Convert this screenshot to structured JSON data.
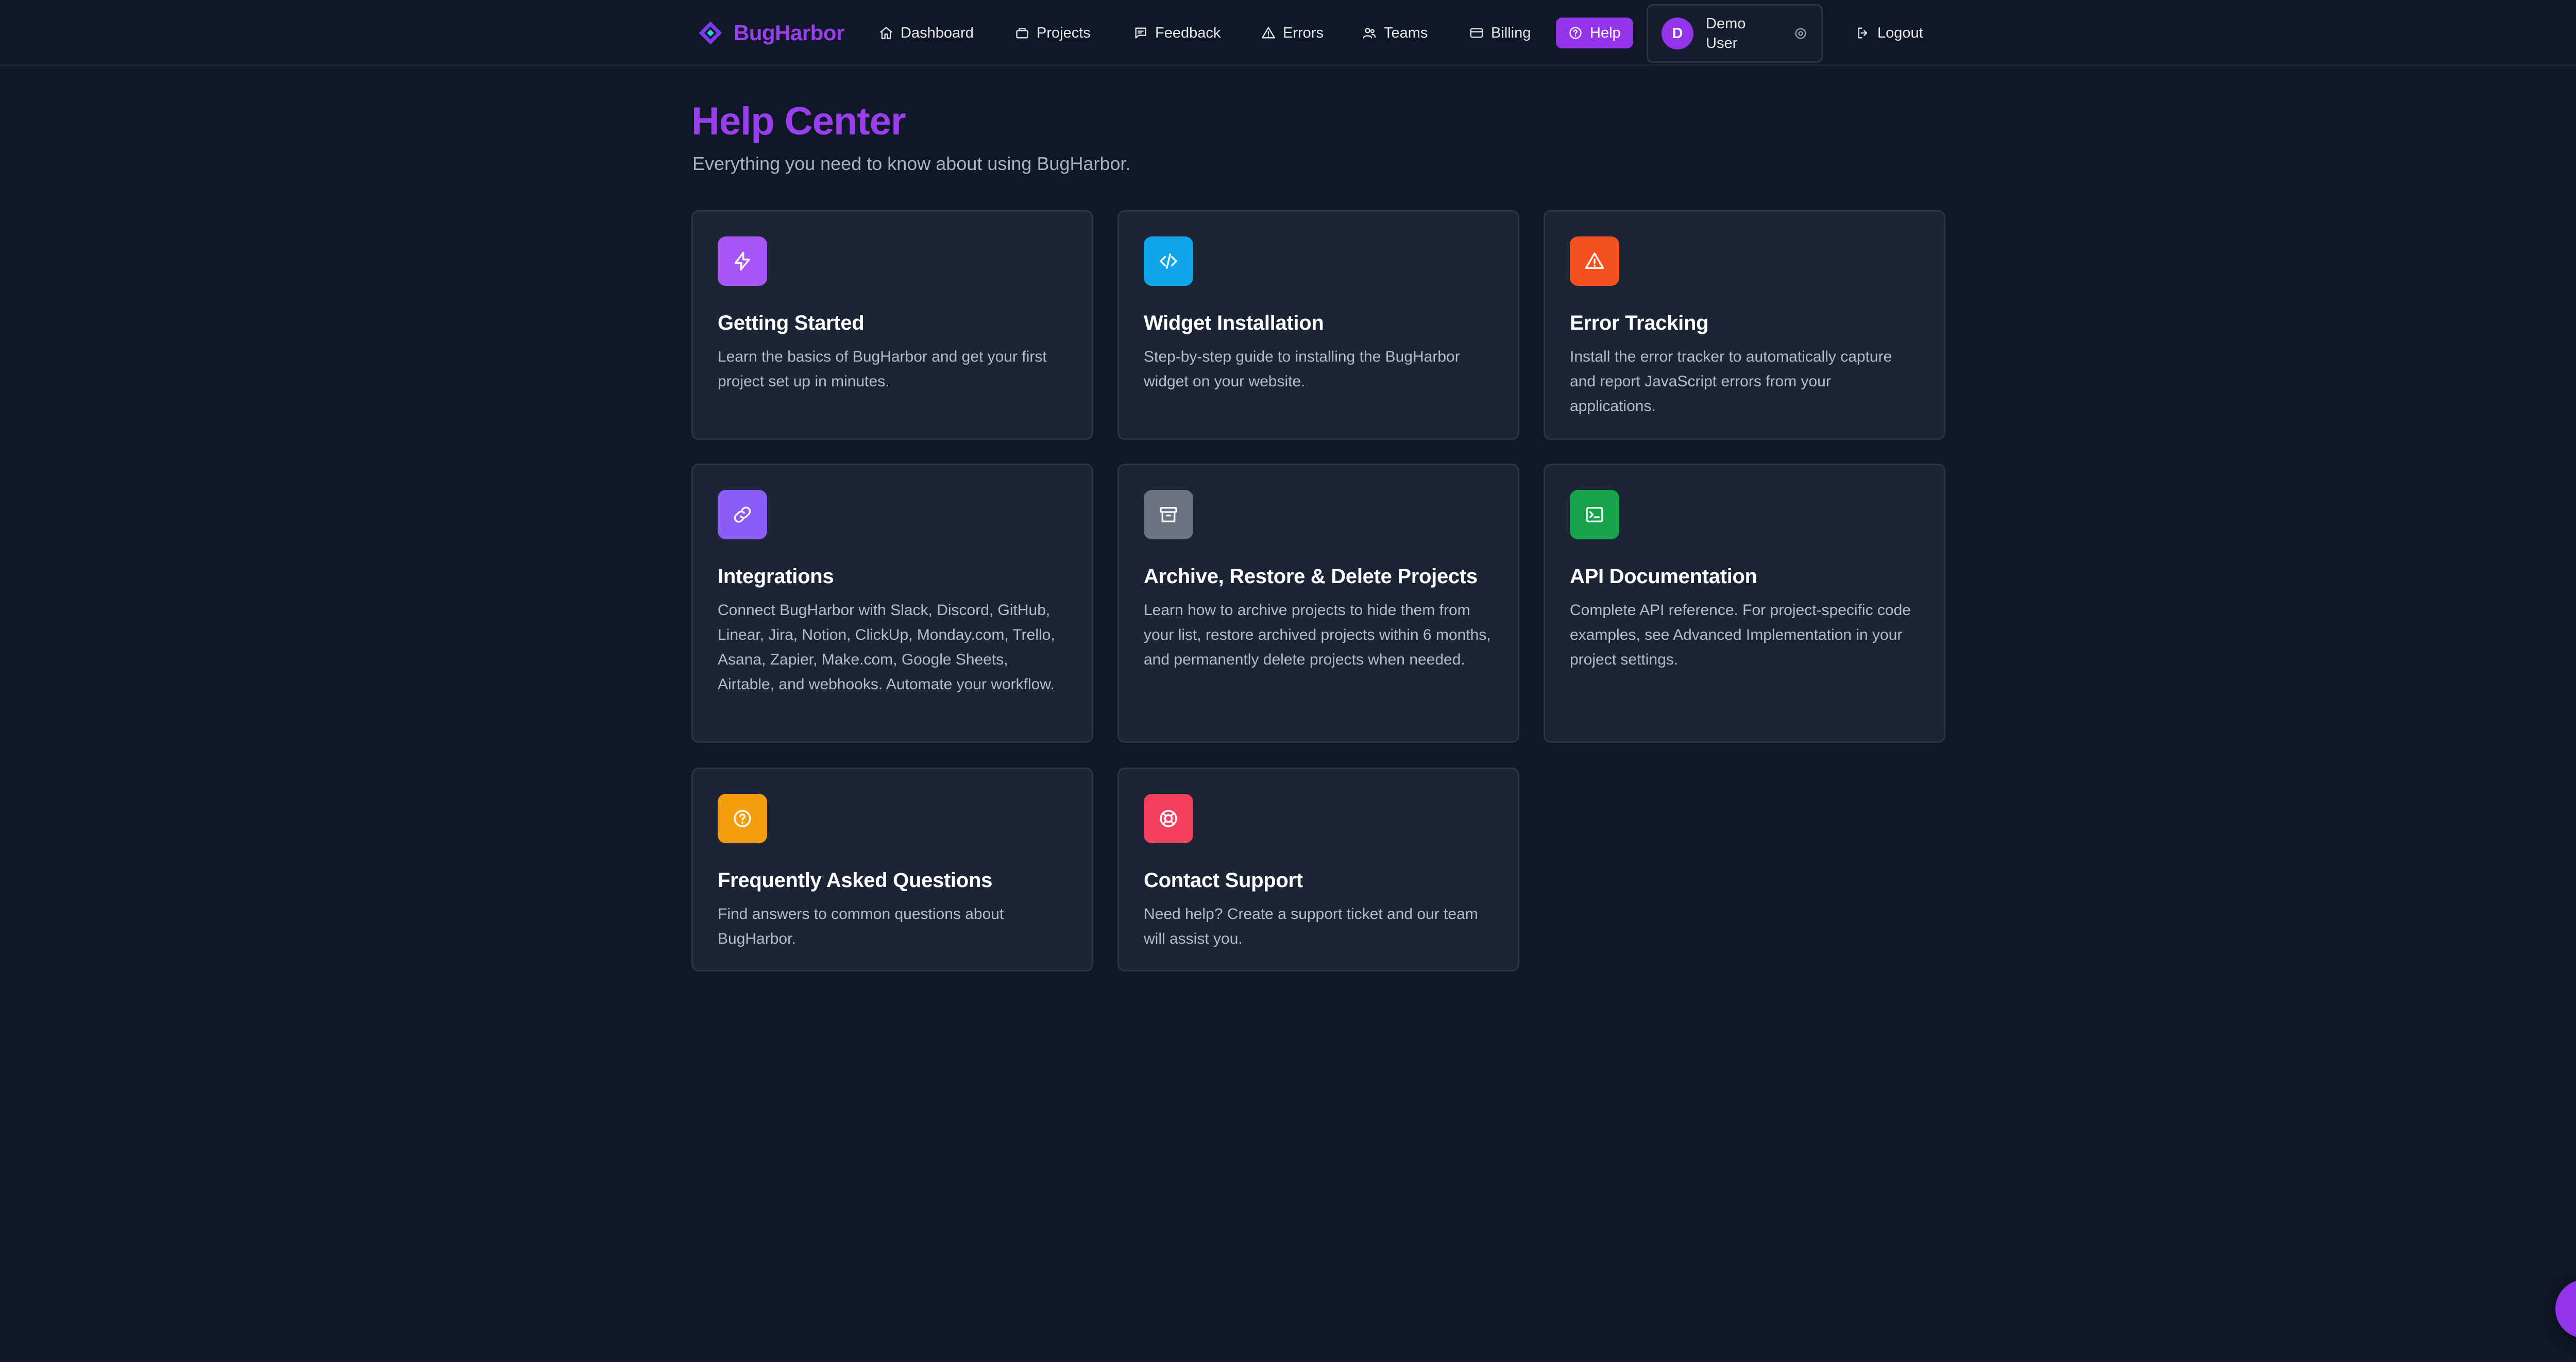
{
  "brand": {
    "name": "BugHarbor",
    "color": "#9b3ef0"
  },
  "nav": {
    "items": [
      {
        "label": "Dashboard",
        "icon": "home-icon"
      },
      {
        "label": "Projects",
        "icon": "folder-icon"
      },
      {
        "label": "Feedback",
        "icon": "message-icon"
      },
      {
        "label": "Errors",
        "icon": "alert-triangle-icon"
      },
      {
        "label": "Teams",
        "icon": "users-icon"
      },
      {
        "label": "Billing",
        "icon": "credit-card-icon"
      },
      {
        "label": "Help",
        "icon": "help-circle-icon",
        "active": true
      }
    ],
    "user": {
      "initial": "D",
      "name": "Demo User",
      "settings_icon": "settings-icon"
    },
    "logout": {
      "label": "Logout",
      "icon": "logout-icon"
    }
  },
  "header": {
    "title": "Help Center",
    "subtitle": "Everything you need to know about using BugHarbor."
  },
  "cards": [
    {
      "title": "Getting Started",
      "description": "Learn the basics of BugHarbor and get your first project set up in minutes.",
      "icon": "lightning-icon",
      "icon_color": "#a855f7"
    },
    {
      "title": "Widget Installation",
      "description": "Step-by-step guide to installing the BugHarbor widget on your website.",
      "icon": "code-icon",
      "icon_color": "#0ea5e9"
    },
    {
      "title": "Error Tracking",
      "description": "Install the error tracker to automatically capture and report JavaScript errors from your applications.",
      "icon": "alert-triangle-icon",
      "icon_color": "#f4511e"
    },
    {
      "title": "Integrations",
      "description": "Connect BugHarbor with Slack, Discord, GitHub, Linear, Jira, Notion, ClickUp, Monday.com, Trello, Asana, Zapier, Make.com, Google Sheets, Airtable, and webhooks. Automate your workflow.",
      "icon": "link-icon",
      "icon_color": "#8b5cf6"
    },
    {
      "title": "Archive, Restore & Delete Projects",
      "description": "Learn how to archive projects to hide them from your list, restore archived projects within 6 months, and permanently delete projects when needed.",
      "icon": "archive-icon",
      "icon_color": "#6b7280"
    },
    {
      "title": "API Documentation",
      "description": "Complete API reference. For project-specific code examples, see Advanced Implementation in your project settings.",
      "icon": "terminal-icon",
      "icon_color": "#16a34a"
    },
    {
      "title": "Frequently Asked Questions",
      "description": "Find answers to common questions about BugHarbor.",
      "icon": "help-circle-icon",
      "icon_color": "#f59e0b"
    },
    {
      "title": "Contact Support",
      "description": "Need help? Create a support ticket and our team will assist you.",
      "icon": "life-buoy-icon",
      "icon_color": "#f43f5e"
    }
  ],
  "chat": {
    "icon": "chat-icon"
  },
  "colors": {
    "background": "#101726",
    "card_background": "#1c2535",
    "accent": "#9333ea"
  }
}
